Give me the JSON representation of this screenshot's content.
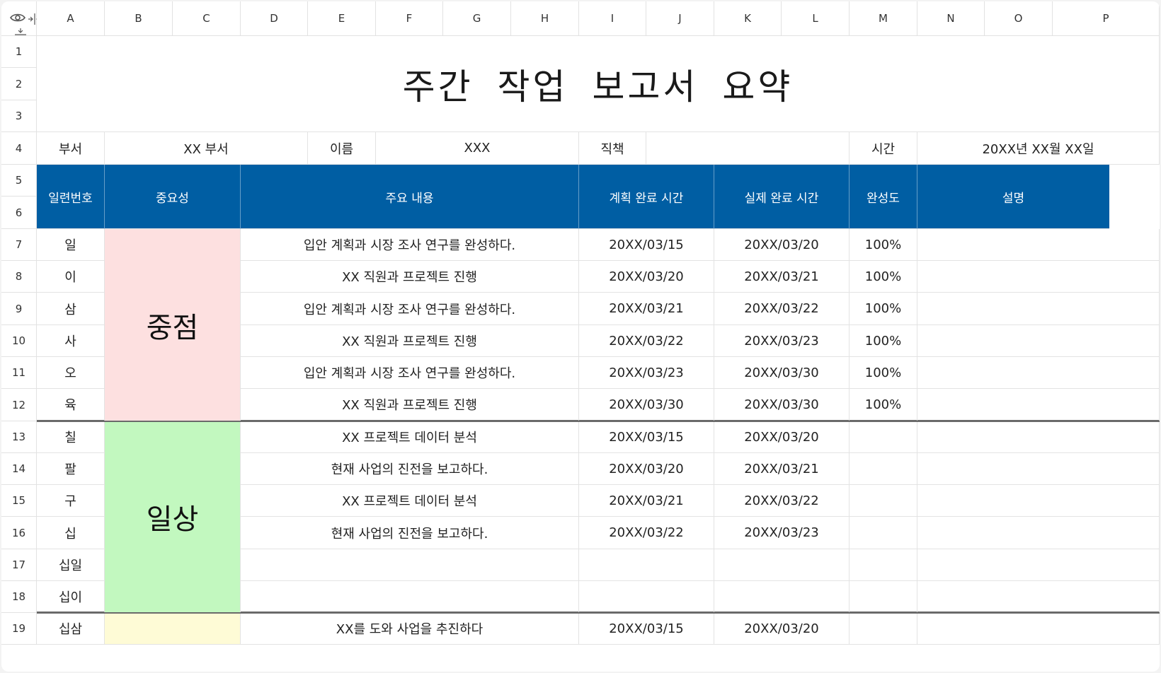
{
  "columns": [
    "A",
    "B",
    "C",
    "D",
    "E",
    "F",
    "G",
    "H",
    "I",
    "J",
    "K",
    "L",
    "M",
    "N",
    "O",
    "P"
  ],
  "rows": [
    "1",
    "2",
    "3",
    "4",
    "5",
    "6",
    "7",
    "8",
    "9",
    "10",
    "11",
    "12",
    "13",
    "14",
    "15",
    "16",
    "17",
    "18",
    "19"
  ],
  "icons": {
    "corner_top": "eye-icon",
    "corner_col_resize": "column-resize-icon",
    "corner_row_resize": "row-resize-icon"
  },
  "colors": {
    "header_bg": "#005ea3",
    "priority_bg": "#fde0e0",
    "daily_bg": "#c2f8bf",
    "other_bg": "#fefbd6"
  },
  "title": "주간 작업 보고서 요약",
  "info": {
    "dept_label": "부서",
    "dept_value": "XX 부서",
    "name_label": "이름",
    "name_value": "XXX",
    "position_label": "직책",
    "position_value": "",
    "time_label": "시간",
    "time_value": "20XX년 XX월 XX일"
  },
  "table_header": {
    "serial": "일련번호",
    "importance": "중요성",
    "content": "주요 내용",
    "planned": "계획 완료 시간",
    "actual": "실제 완료 시간",
    "completion": "완성도",
    "description": "설명"
  },
  "groups": {
    "priority": "중점",
    "daily": "일상"
  },
  "table_rows": [
    {
      "serial": "일",
      "content": "입안 계획과 시장 조사 연구를 완성하다.",
      "planned": "20XX/03/15",
      "actual": "20XX/03/20",
      "completion": "100%",
      "description": ""
    },
    {
      "serial": "이",
      "content": "XX 직원과 프로젝트 진행",
      "planned": "20XX/03/20",
      "actual": "20XX/03/21",
      "completion": "100%",
      "description": ""
    },
    {
      "serial": "삼",
      "content": "입안 계획과 시장 조사 연구를 완성하다.",
      "planned": "20XX/03/21",
      "actual": "20XX/03/22",
      "completion": "100%",
      "description": ""
    },
    {
      "serial": "사",
      "content": "XX 직원과 프로젝트 진행",
      "planned": "20XX/03/22",
      "actual": "20XX/03/23",
      "completion": "100%",
      "description": ""
    },
    {
      "serial": "오",
      "content": "입안 계획과 시장 조사 연구를 완성하다.",
      "planned": "20XX/03/23",
      "actual": "20XX/03/30",
      "completion": "100%",
      "description": ""
    },
    {
      "serial": "육",
      "content": "XX 직원과 프로젝트 진행",
      "planned": "20XX/03/30",
      "actual": "20XX/03/30",
      "completion": "100%",
      "description": ""
    },
    {
      "serial": "칠",
      "content": "XX 프로젝트 데이터 분석",
      "planned": "20XX/03/15",
      "actual": "20XX/03/20",
      "completion": "",
      "description": ""
    },
    {
      "serial": "팔",
      "content": "현재 사업의 진전을 보고하다.",
      "planned": "20XX/03/20",
      "actual": "20XX/03/21",
      "completion": "",
      "description": ""
    },
    {
      "serial": "구",
      "content": "XX 프로젝트 데이터 분석",
      "planned": "20XX/03/21",
      "actual": "20XX/03/22",
      "completion": "",
      "description": ""
    },
    {
      "serial": "십",
      "content": "현재 사업의 진전을 보고하다.",
      "planned": "20XX/03/22",
      "actual": "20XX/03/23",
      "completion": "",
      "description": ""
    },
    {
      "serial": "십일",
      "content": "",
      "planned": "",
      "actual": "",
      "completion": "",
      "description": ""
    },
    {
      "serial": "십이",
      "content": "",
      "planned": "",
      "actual": "",
      "completion": "",
      "description": ""
    },
    {
      "serial": "십삼",
      "content": "XX를 도와 사업을 추진하다",
      "planned": "20XX/03/15",
      "actual": "20XX/03/20",
      "completion": "",
      "description": ""
    }
  ]
}
